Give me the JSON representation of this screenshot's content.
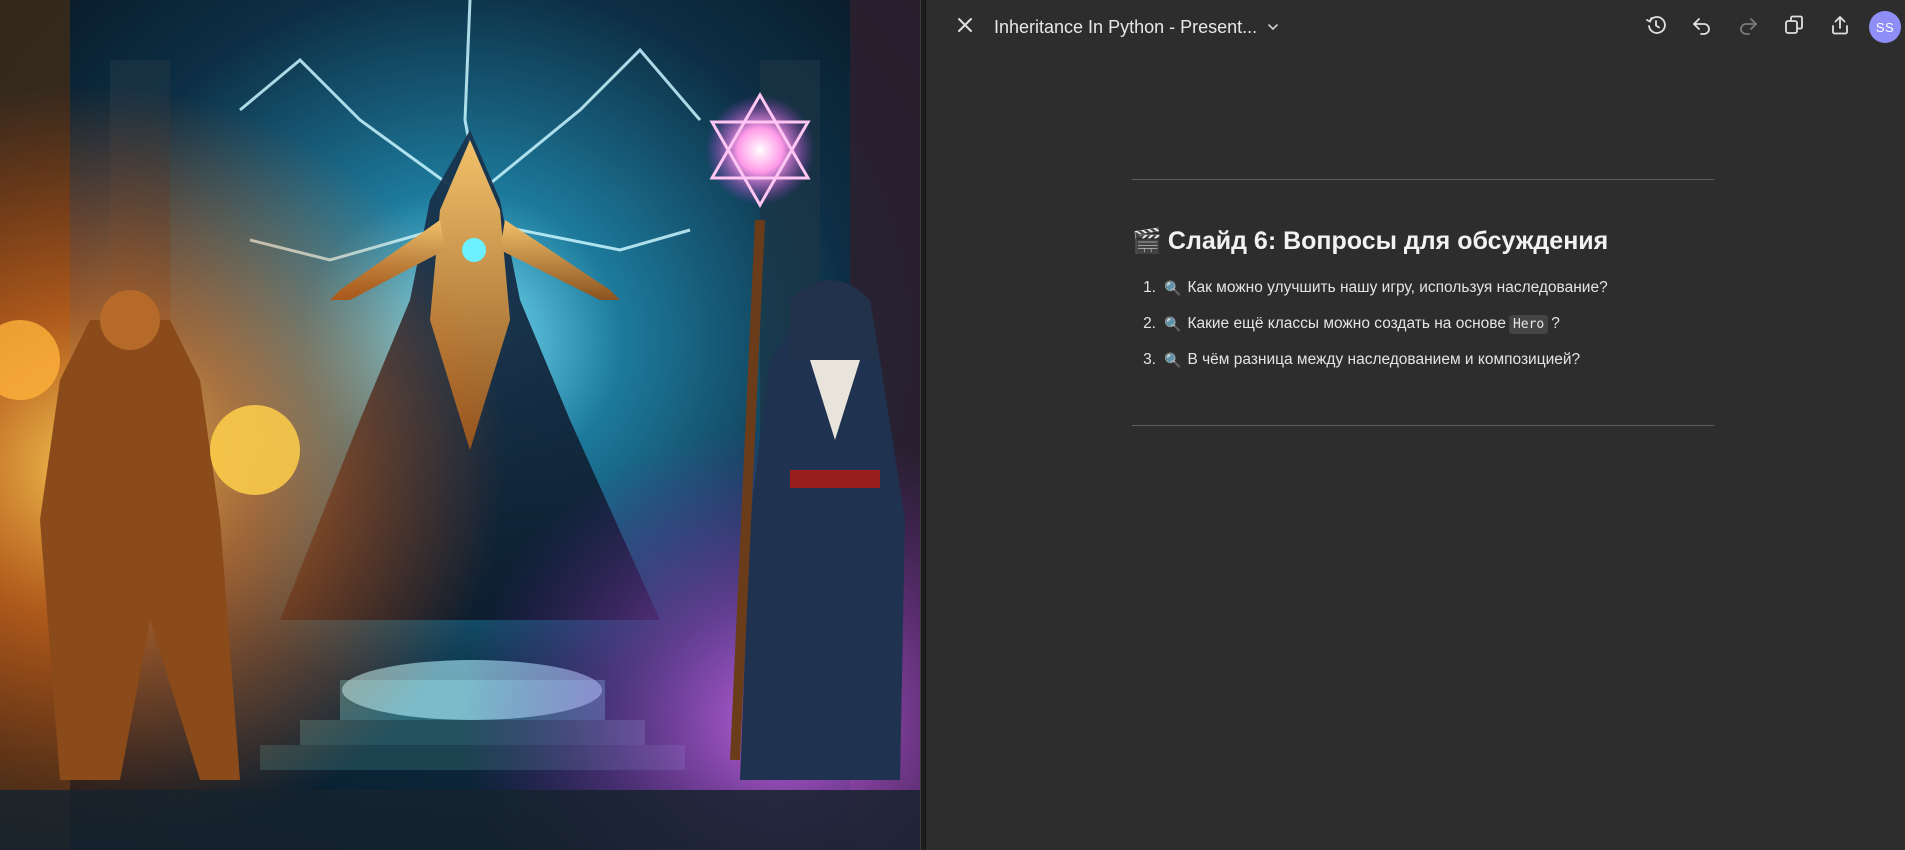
{
  "editor": {
    "title": "Inheritance In Python - Present...",
    "avatar_initials": "SS",
    "icons": [
      "close-icon",
      "chevron-down-icon",
      "history-icon",
      "undo-icon",
      "redo-icon",
      "duplicate-icon",
      "share-icon"
    ]
  },
  "slide": {
    "emoji": "🎬",
    "title": "Слайд 6: Вопросы для обсуждения",
    "questions": [
      {
        "number": "1.",
        "icon": "🔍",
        "text": "Как можно улучшить нашу игру, используя наследование?"
      },
      {
        "number": "2.",
        "icon": "🔍",
        "text_before": "Какие ещё классы можно создать на основе",
        "code": "Hero",
        "text_after": "?"
      },
      {
        "number": "3.",
        "icon": "🔍",
        "text": "В чём разница между наследованием и композицией?"
      }
    ]
  },
  "colors": {
    "background": "#2d2d2d",
    "avatar": "#8f8ef6",
    "text": "#e6e6e6"
  }
}
